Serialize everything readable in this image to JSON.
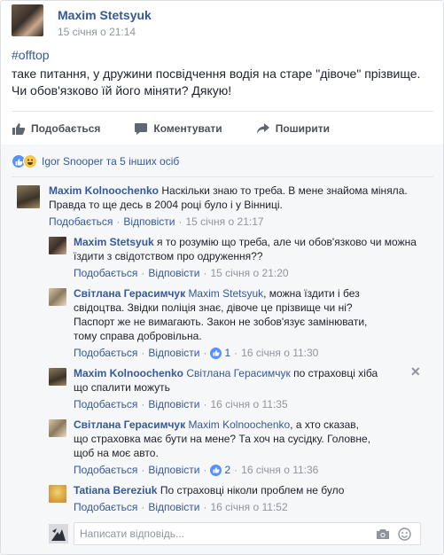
{
  "post": {
    "author": "Maxim Stetsyuk",
    "time": "15 січня о 21:14",
    "hashtag": "#offtop",
    "text": "таке питання, у дружини посвідчення водія на старе \"дівоче\" прізвище. Чи обов'язково їй його міняти? Дякую!"
  },
  "actions": {
    "like": "Подобається",
    "comment": "Коментувати",
    "share": "Поширити"
  },
  "reactions": {
    "text": "Igor Snooper та 5 інших осіб"
  },
  "comments": [
    {
      "author": "Maxim Kolnoochenko",
      "mention": "",
      "text": "Наскільки знаю то треба. В мене знайома міняла. Правда то ще десь в 2004 році було і у Вінниці.",
      "like_label": "Подобається",
      "reply_label": "Відповісти",
      "likes": "",
      "time": "15 січня о 21:17"
    },
    {
      "author": "Maxim Stetsyuk",
      "mention": "",
      "text": "я то розумію що треба, але чи обов'язково чи можна їздити з свідотством про одруження??",
      "like_label": "Подобається",
      "reply_label": "Відповісти",
      "likes": "",
      "time": "15 січня о 21:20"
    },
    {
      "author": "Світлана Герасимчук",
      "mention": "Maxim Stetsyuk",
      "text": ", можна їздити і без свідоцтва. Звідки поліція знає, дівоче це прізвище чи ні? Паспорт же не вимагають. Закон не зобов'язує замінювати, тому справа добровільна.",
      "like_label": "Подобається",
      "reply_label": "Відповісти",
      "likes": "1",
      "time": "16 січня о 11:30"
    },
    {
      "author": "Maxim Kolnoochenko",
      "mention": "Світлана Герасимчук",
      "text": " по страховці хіба що спалити можуть",
      "like_label": "Подобається",
      "reply_label": "Відповісти",
      "likes": "",
      "time": "16 січня о 11:35"
    },
    {
      "author": "Світлана Герасимчук",
      "mention": "Maxim Kolnoochenko",
      "text": ", а хто сказав, що страховка має бути на мене? Та хоч на сусідку. Головне, щоб на моє авто.",
      "like_label": "Подобається",
      "reply_label": "Відповісти",
      "likes": "2",
      "time": "16 січня о 11:36"
    },
    {
      "author": "Tatiana Bereziuk",
      "mention": "",
      "text": "По страховці ніколи проблем не було",
      "like_label": "Подобається",
      "reply_label": "Відповісти",
      "likes": "",
      "time": "16 січня о 11:52"
    }
  ],
  "reply_box": {
    "placeholder": "Написати відповідь..."
  },
  "colors": {
    "link": "#365899",
    "meta": "#90949c",
    "like_blue": "#5890ff",
    "comments_bg": "#f6f7f9"
  }
}
